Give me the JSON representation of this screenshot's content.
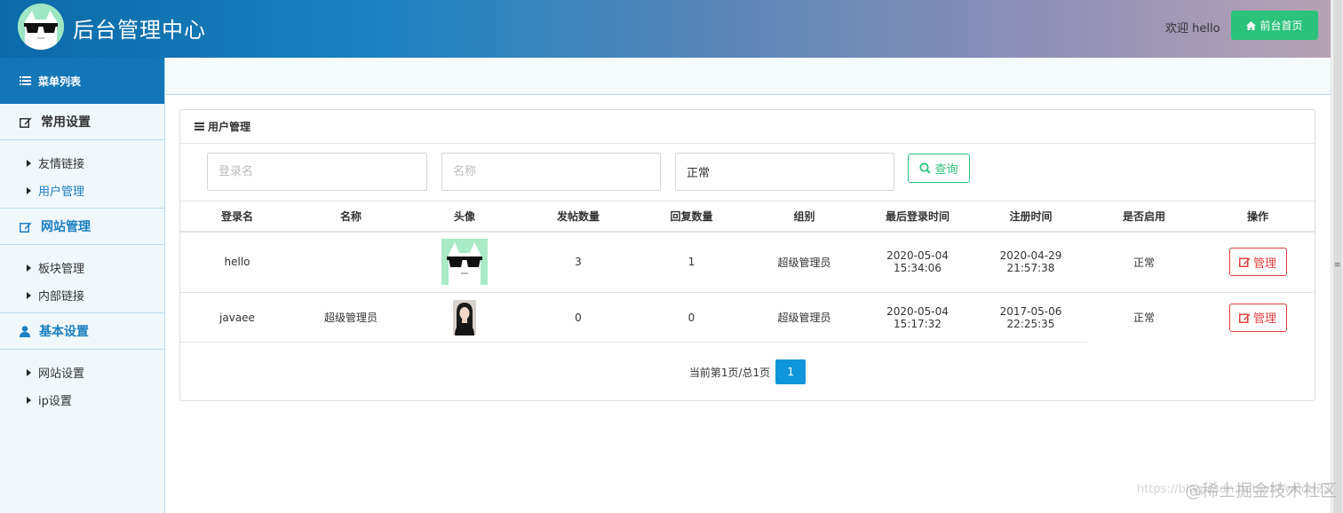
{
  "header": {
    "title": "后台管理中心",
    "welcome": "欢迎 hello",
    "home_button": "前台首页"
  },
  "sidebar": {
    "menu_title": "菜单列表",
    "groups": [
      {
        "label": "常用设置",
        "items": [
          "友情链接",
          "用户管理"
        ],
        "active_item": "用户管理"
      },
      {
        "label": "网站管理",
        "items": [
          "板块管理",
          "内部链接"
        ]
      },
      {
        "label": "基本设置",
        "items": [
          "网站设置",
          "ip设置"
        ]
      }
    ]
  },
  "panel": {
    "title": "用户管理",
    "search": {
      "login_placeholder": "登录名",
      "name_placeholder": "名称",
      "status_value": "正常",
      "button": "查询"
    },
    "table": {
      "headers": [
        "登录名",
        "名称",
        "头像",
        "发帖数量",
        "回复数量",
        "组别",
        "最后登录时间",
        "注册时间",
        "是否启用",
        "操作"
      ],
      "rows": [
        {
          "login": "hello",
          "name": "",
          "avatar": "sunglasses-avatar",
          "posts": "3",
          "replies": "1",
          "group": "超级管理员",
          "last_login_date": "2020-05-04",
          "last_login_time": "15:34:06",
          "reg_date": "2020-04-29",
          "reg_time": "21:57:38",
          "status": "正常",
          "action": "管理"
        },
        {
          "login": "javaee",
          "name": "超级管理员",
          "avatar": "photo-avatar",
          "posts": "0",
          "replies": "0",
          "group": "超级管理员",
          "last_login_date": "2020-05-04",
          "last_login_time": "15:17:32",
          "reg_date": "2017-05-06",
          "reg_time": "22:25:35",
          "status": "正常",
          "action": "管理"
        }
      ]
    },
    "pagination": {
      "text": "当前第1页/总1页",
      "current": "1"
    }
  },
  "watermark": {
    "url": "https://blog.csdn.net/whhwhdd22",
    "text": "@稀土掘金技术社区"
  },
  "colors": {
    "primary": "#1376b6",
    "success": "#2bc27c",
    "danger": "#e0423f",
    "page_active": "#1296db"
  }
}
